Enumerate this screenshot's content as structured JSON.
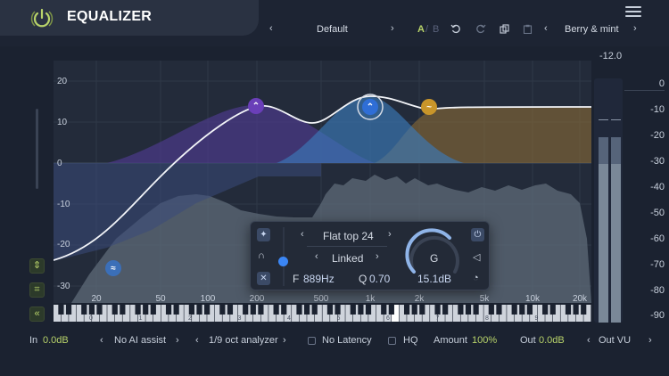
{
  "header": {
    "title": "EQUALIZER",
    "power_icon": "power-icon",
    "menu_icon": "hamburger-menu-icon"
  },
  "preset_bar": {
    "prev_chevron": "‹",
    "next_chevron": "›",
    "preset_name": "Default",
    "ab_a": "A",
    "ab_sep": "/",
    "ab_b": "B",
    "theme_prev": "‹",
    "theme_name": "Berry & mint",
    "theme_next": "›"
  },
  "plot": {
    "db_labels": [
      "20",
      "10",
      "0",
      "-10",
      "-20",
      "-30"
    ],
    "freq_labels": [
      "20",
      "50",
      "100",
      "200",
      "500",
      "1k",
      "2k",
      "5k",
      "10k",
      "20k"
    ],
    "piano_octaves": [
      "0",
      "1",
      "2",
      "3",
      "4",
      "5",
      "6",
      "7",
      "8",
      "9"
    ],
    "bands": [
      {
        "name": "low-shelf",
        "color": "#3b6fb8",
        "glyph": "≈"
      },
      {
        "name": "peak-1",
        "color": "#6a3fb8",
        "glyph": "⌃"
      },
      {
        "name": "flat-top",
        "color": "#2f6ed6",
        "glyph": "⌃"
      },
      {
        "name": "high-shelf",
        "color": "#c8952a",
        "glyph": "~"
      }
    ],
    "colors": {
      "purple_fill": "#4b3b8a",
      "blue_fill": "#3a79b8",
      "orange_fill": "#8a6a36",
      "spectrum": "#5f6b78",
      "curve": "#f2f4f8"
    }
  },
  "tools": {
    "fit_icon": "fit-vertical-icon",
    "crop_icon": "crop-icon",
    "collapse_icon": "double-chevron-left-icon"
  },
  "popup": {
    "filter_type": "Flat top 24",
    "stereo_mode": "Linked",
    "freq_label": "F",
    "freq_value": "889Hz",
    "q_label": "Q",
    "q_value": "0.70",
    "gain_label": "G",
    "gain_value": "15.1dB",
    "chev_left": "‹",
    "chev_right": "›"
  },
  "meter": {
    "top_value": "-12.0",
    "scale": [
      "0",
      "-10",
      "-20",
      "-30",
      "-40",
      "-50",
      "-60",
      "-70",
      "-80",
      "-90"
    ]
  },
  "bottom": {
    "in_label": "In",
    "in_value": "0.0dB",
    "ai_assist": "No AI assist",
    "analyzer": "1/9 oct analyzer",
    "latency": "No Latency",
    "hq": "HQ",
    "amount_label": "Amount",
    "amount_value": "100%",
    "out_label": "Out",
    "out_value": "0.0dB",
    "out_vu": "Out VU",
    "chev_left": "‹",
    "chev_right": "›"
  }
}
